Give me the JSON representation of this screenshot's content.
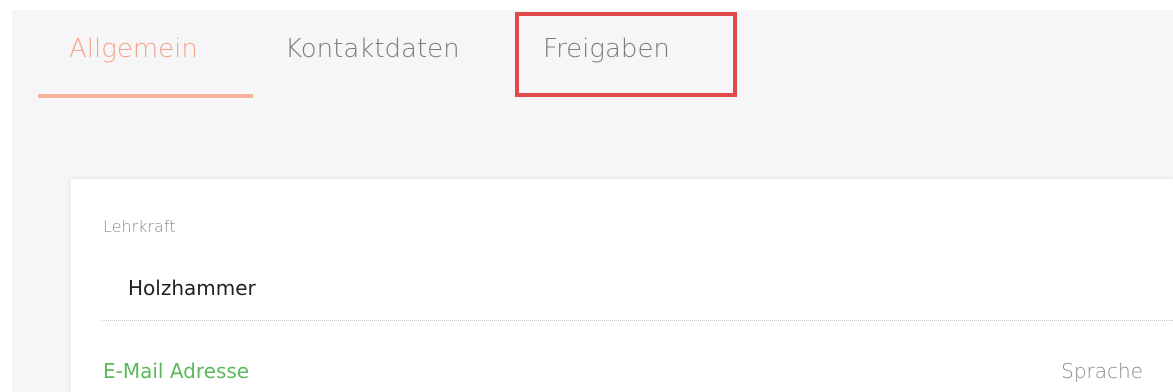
{
  "tabs": [
    {
      "label": "Allgemein",
      "active": true
    },
    {
      "label": "Kontaktdaten",
      "active": false
    },
    {
      "label": "Freigaben",
      "active": false,
      "highlighted": true
    }
  ],
  "form": {
    "teacher_label": "Lehrkraft",
    "teacher_value": "Holzhammer",
    "email_label": "E-Mail Adresse",
    "language_label": "Sprache"
  },
  "colors": {
    "active_tab": "#f3a488",
    "highlight_box": "#e04a4a",
    "email_label": "#5cb85c"
  }
}
